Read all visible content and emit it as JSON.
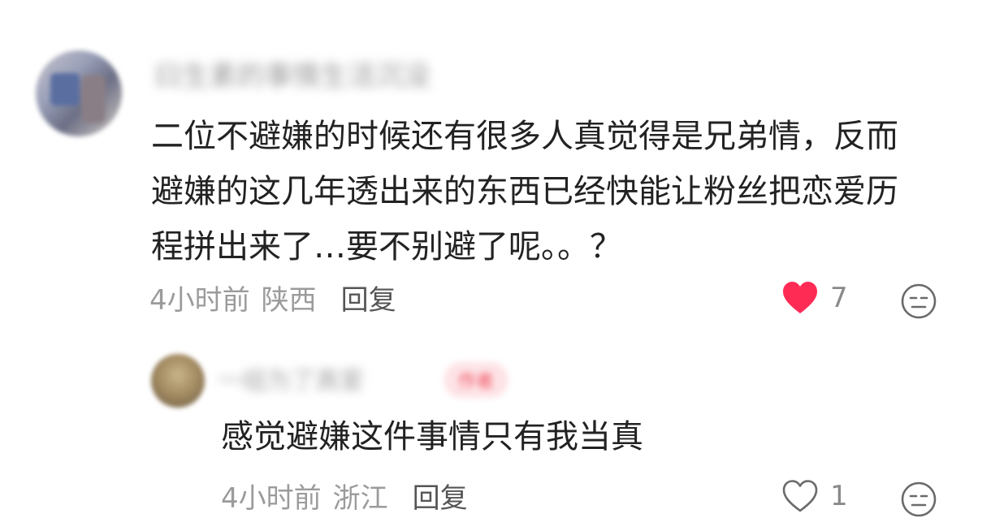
{
  "comment": {
    "username": "曰生素的事情生活沉没",
    "text_lines": [
      "二位不避嫌的时候还有很多人真觉得是兄弟情，反而",
      "避嫌的这几年透出来的东西已经快能让粉丝把恋爱历",
      "程拼出来了…要不别避了呢。。？"
    ],
    "time": "4小时前",
    "location": "陕西",
    "reply_label": "回复",
    "like_count": "7",
    "liked": true
  },
  "reply": {
    "username": "一组为了真爱",
    "badge": "作者",
    "text": "感觉避嫌这件事情只有我当真",
    "time": "4小时前",
    "location": "浙江",
    "reply_label": "回复",
    "like_count": "1",
    "liked": false
  },
  "colors": {
    "like_active": "#fe2c55",
    "meta_gray": "#9b9b9b",
    "text": "#222222"
  },
  "icons": {
    "like_filled": "heart-filled-icon",
    "like_outline": "heart-outline-icon",
    "dislike": "meh-face-icon"
  }
}
